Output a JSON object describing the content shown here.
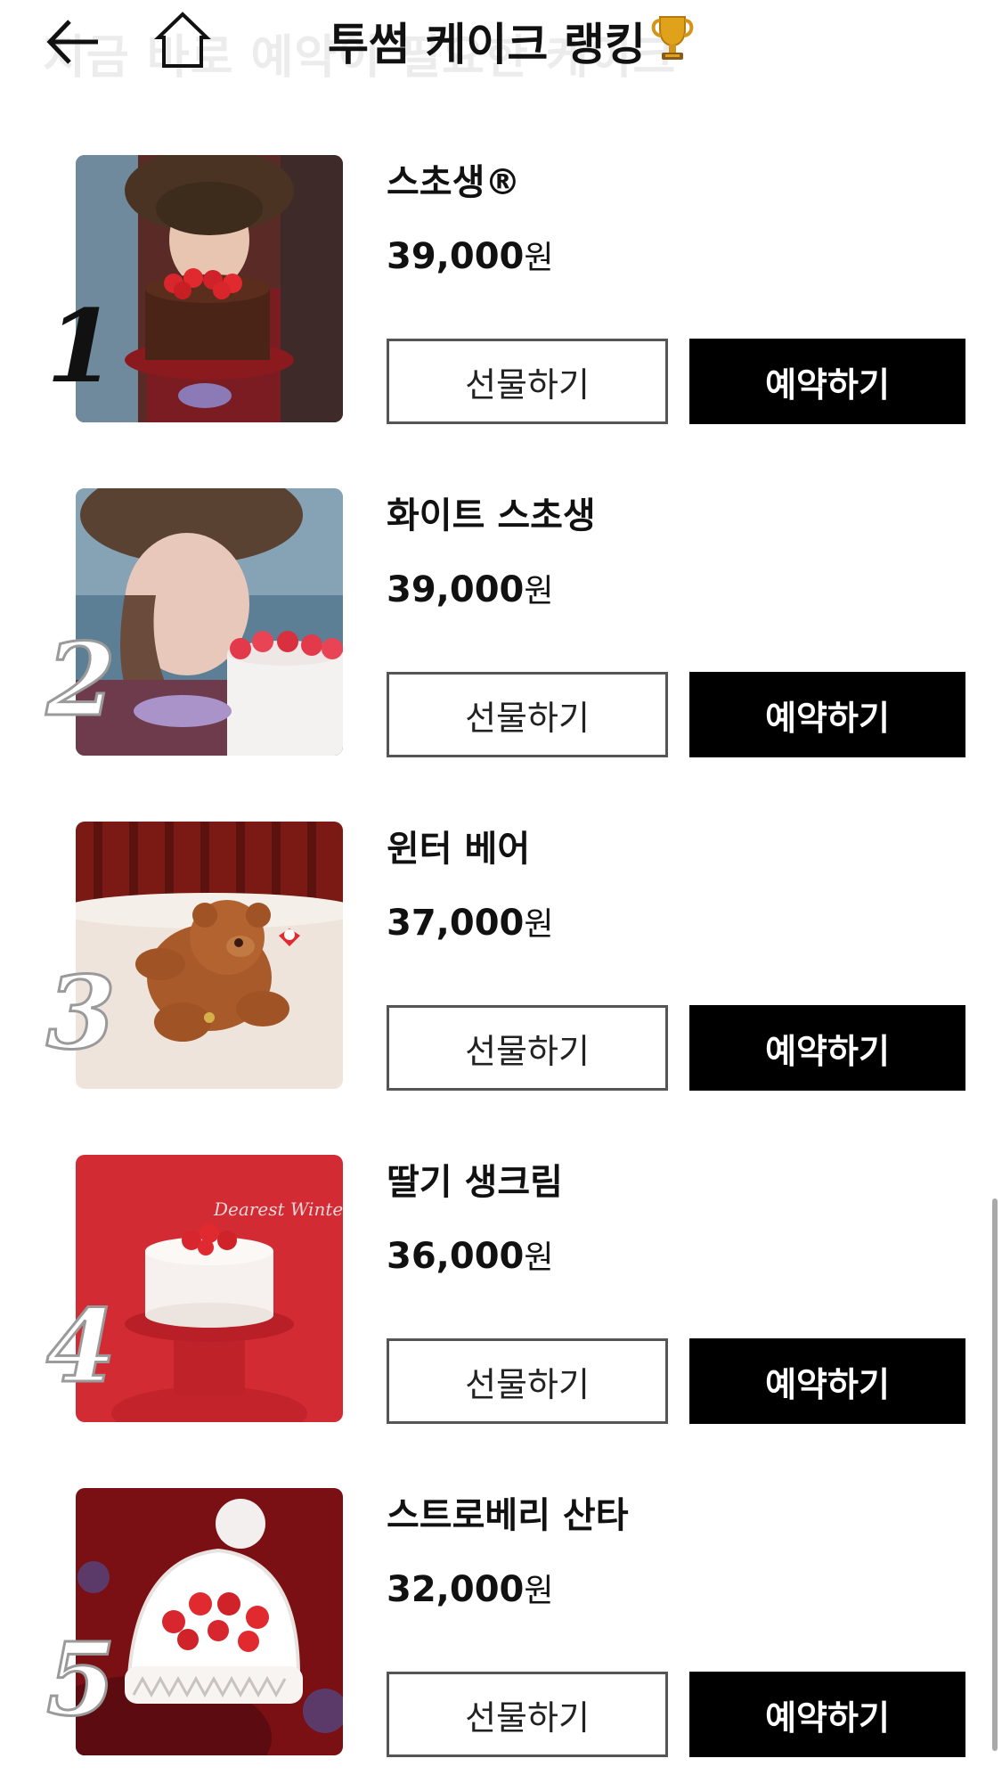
{
  "header": {
    "ghost_text": "지금 바로 예약이 필요한 케이크",
    "title": "투썸 케이크 랭킹",
    "back_icon": "back-arrow-icon",
    "home_icon": "home-icon",
    "trophy_icon": "trophy-icon"
  },
  "buttons": {
    "gift": "선물하기",
    "reserve": "예약하기"
  },
  "currency": "원",
  "products": [
    {
      "rank": "1",
      "name": "스초생®",
      "price": "39,000",
      "image": "strawberry-chocolate-cake-photo"
    },
    {
      "rank": "2",
      "name": "화이트 스초생",
      "price": "39,000",
      "image": "white-strawberry-cake-photo"
    },
    {
      "rank": "3",
      "name": "윈터 베어",
      "price": "37,000",
      "image": "bear-cake-photo"
    },
    {
      "rank": "4",
      "name": "딸기 생크림",
      "price": "36,000",
      "image": "strawberry-cream-cake-photo"
    },
    {
      "rank": "5",
      "name": "스트로베리 산타",
      "price": "32,000",
      "image": "santa-hat-cake-photo"
    }
  ],
  "thumb_text": {
    "dearest_winter": "Dearest Winter"
  }
}
